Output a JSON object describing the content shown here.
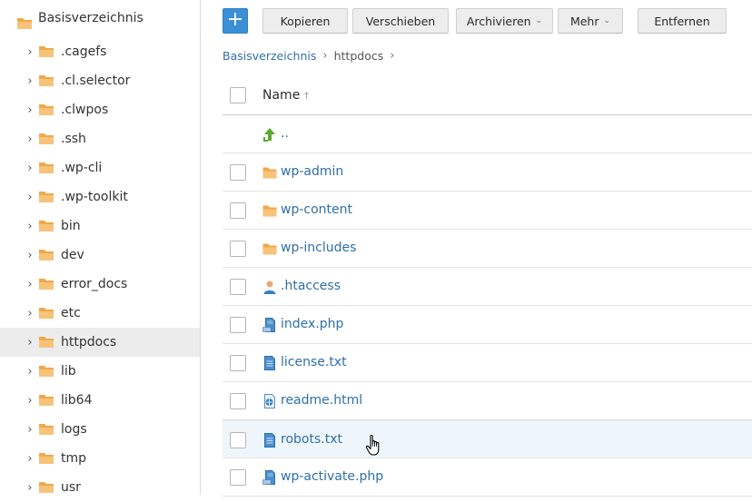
{
  "sidebar": {
    "root_label": "Basisverzeichnis",
    "items": [
      {
        "label": ".cagefs",
        "selected": false
      },
      {
        "label": ".cl.selector",
        "selected": false
      },
      {
        "label": ".clwpos",
        "selected": false
      },
      {
        "label": ".ssh",
        "selected": false
      },
      {
        "label": ".wp-cli",
        "selected": false
      },
      {
        "label": ".wp-toolkit",
        "selected": false
      },
      {
        "label": "bin",
        "selected": false
      },
      {
        "label": "dev",
        "selected": false
      },
      {
        "label": "error_docs",
        "selected": false
      },
      {
        "label": "etc",
        "selected": false
      },
      {
        "label": "httpdocs",
        "selected": true
      },
      {
        "label": "lib",
        "selected": false
      },
      {
        "label": "lib64",
        "selected": false
      },
      {
        "label": "logs",
        "selected": false
      },
      {
        "label": "tmp",
        "selected": false
      },
      {
        "label": "usr",
        "selected": false
      }
    ]
  },
  "toolbar": {
    "add_label": "+",
    "copy_label": "Kopieren",
    "move_label": "Verschieben",
    "archive_label": "Archivieren",
    "more_label": "Mehr",
    "remove_label": "Entfernen"
  },
  "breadcrumb": {
    "root": "Basisverzeichnis",
    "current": "httpdocs"
  },
  "list": {
    "header_name": "Name",
    "parent_label": "..",
    "files": [
      {
        "name": "wp-admin",
        "icon": "folder-icon"
      },
      {
        "name": "wp-content",
        "icon": "folder-icon"
      },
      {
        "name": "wp-includes",
        "icon": "folder-icon"
      },
      {
        "name": ".htaccess",
        "icon": "user-file-icon"
      },
      {
        "name": "index.php",
        "icon": "php-file-icon"
      },
      {
        "name": "license.txt",
        "icon": "text-file-icon"
      },
      {
        "name": "readme.html",
        "icon": "html-file-icon"
      },
      {
        "name": "robots.txt",
        "icon": "text-file-icon",
        "hovered": true
      },
      {
        "name": "wp-activate.php",
        "icon": "php-file-icon"
      }
    ]
  },
  "colors": {
    "accent": "#3a8fd6",
    "link": "#2f6fa8",
    "folder": "#f0a848",
    "selected_bg": "#ececec",
    "hover_bg": "#eef6fb"
  }
}
